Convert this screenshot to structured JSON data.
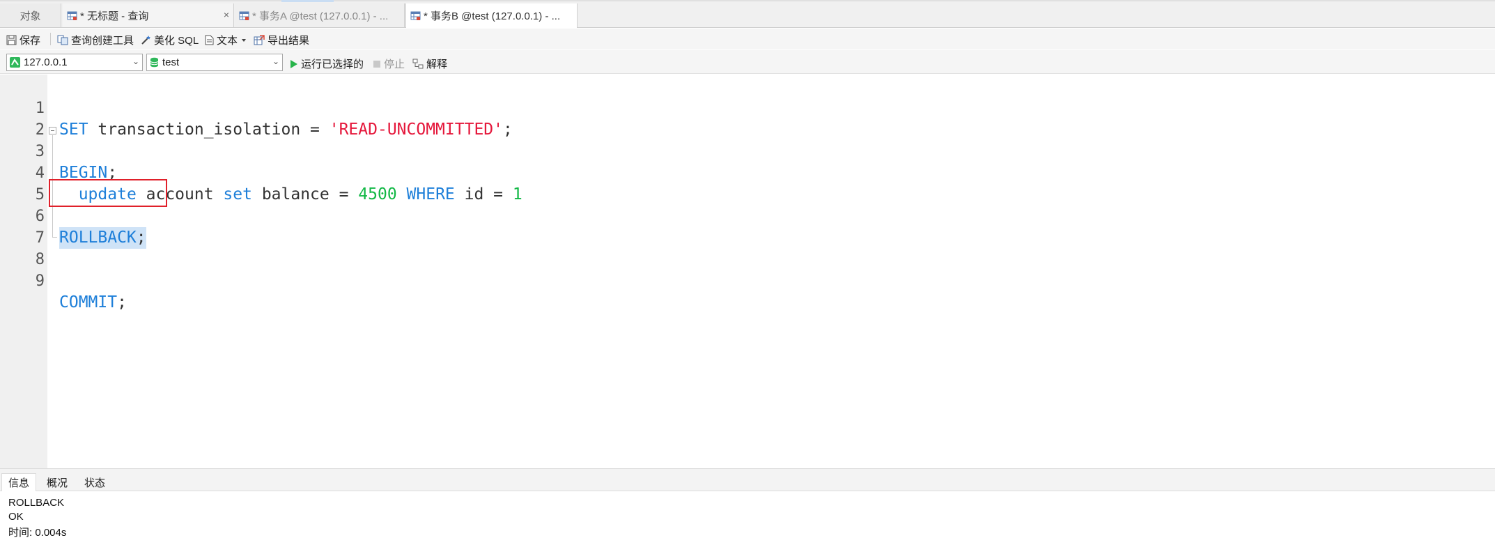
{
  "tabs": {
    "objects": "对象",
    "items": [
      {
        "label": "* 无标题 - 查询"
      },
      {
        "label": "* 事务A @test (127.0.0.1) - ..."
      },
      {
        "label": "* 事务B @test (127.0.0.1) - ..."
      }
    ],
    "close_glyph": "×"
  },
  "toolbar": {
    "save": "保存",
    "query_builder": "查询创建工具",
    "beautify": "美化 SQL",
    "text": "文本",
    "export": "导出结果",
    "run_selected": "运行已选择的",
    "stop": "停止",
    "explain": "解释"
  },
  "connection": {
    "value": "127.0.0.1"
  },
  "database": {
    "value": "test"
  },
  "editor": {
    "line_numbers": [
      "1",
      "2",
      "3",
      "4",
      "5",
      "6",
      "7",
      "8",
      "9"
    ],
    "lines": {
      "l1": {
        "kw1": "SET",
        "plain1": " transaction_isolation = ",
        "str1": "'READ-UNCOMMITTED'",
        "plain2": ";"
      },
      "l3": {
        "kw1": "BEGIN",
        "plain1": ";"
      },
      "l4": {
        "indent": "  ",
        "kw1": "update",
        "plain1": " account ",
        "kw2": "set",
        "plain2": " balance = ",
        "num1": "4500",
        "plain3": " ",
        "kw3": "WHERE",
        "plain4": " id = ",
        "num2": "1"
      },
      "l6": {
        "kw1": "ROLLBACK",
        "plain1": ";"
      },
      "l9": {
        "kw1": "COMMIT",
        "plain1": ";"
      }
    }
  },
  "result_panel": {
    "tabs": [
      "信息",
      "概况",
      "状态"
    ],
    "messages": [
      "ROLLBACK",
      "OK",
      "时间: 0.004s"
    ]
  },
  "colors": {
    "keyword": "#1e7fd9",
    "string": "#e5173b",
    "number": "#11b845",
    "highlight_box": "#e0202a"
  }
}
